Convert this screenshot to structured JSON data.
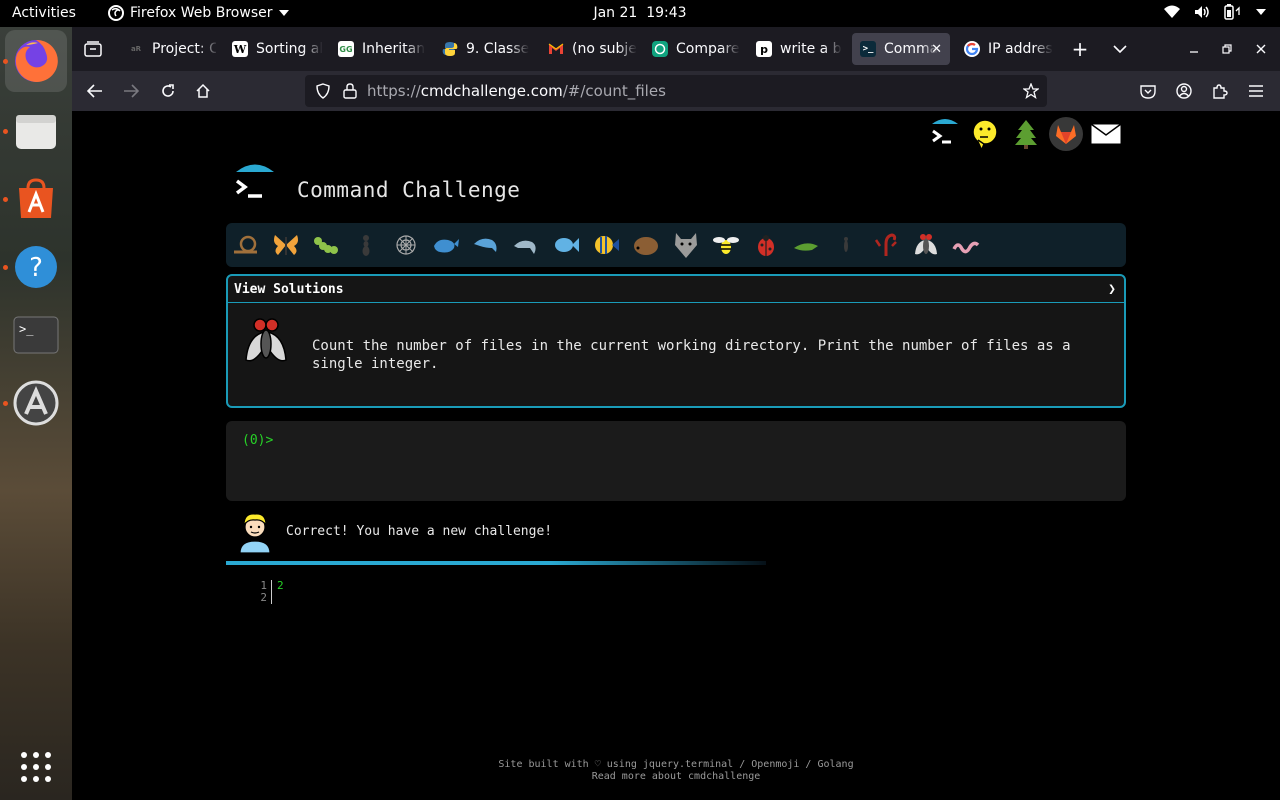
{
  "topbar": {
    "activities": "Activities",
    "app_name": "Firefox Web Browser",
    "date": "Jan 21",
    "time": "19:43",
    "icons": [
      "wifi-icon",
      "volume-icon",
      "battery-icon",
      "power-menu-icon"
    ]
  },
  "dock": {
    "items": [
      {
        "name": "firefox",
        "running": true
      },
      {
        "name": "files",
        "running": true
      },
      {
        "name": "app-center",
        "running": true
      },
      {
        "name": "help",
        "running": true
      },
      {
        "name": "terminal",
        "running": false
      },
      {
        "name": "software-updater",
        "running": true
      }
    ],
    "show_apps": "show-apps-icon"
  },
  "tabs": [
    {
      "label": "Project: C",
      "favicon": "project-icon",
      "active": false
    },
    {
      "label": "Sorting al",
      "favicon": "wikipedia-icon",
      "active": false
    },
    {
      "label": "Inheritan",
      "favicon": "geeksforgeeks-icon",
      "active": false
    },
    {
      "label": "9. Classe",
      "favicon": "python-icon",
      "active": false
    },
    {
      "label": "(no subje",
      "favicon": "gmail-icon",
      "active": false
    },
    {
      "label": "Compare",
      "favicon": "chatgpt-icon",
      "active": false
    },
    {
      "label": "write a b",
      "favicon": "perplexity-icon",
      "active": false
    },
    {
      "label": "Comma",
      "favicon": "cmdchallenge-icon",
      "active": true
    },
    {
      "label": "IP addres",
      "favicon": "google-icon",
      "active": false
    }
  ],
  "url": {
    "proto": "https://",
    "domain": "cmdchallenge.com",
    "path": "/#/count_files"
  },
  "site": {
    "title": "Command Challenge",
    "view_solutions": "View Solutions",
    "chevron": "❯",
    "challenge_text": "Count the number of files in the current working directory. Print the number of files as a single integer.",
    "prompt": "(0)>",
    "feedback": "Correct! You have a new challenge!",
    "output_lines": [
      {
        "num": "1",
        "text": "2"
      },
      {
        "num": "2",
        "text": ""
      }
    ],
    "footer_line1": "Site built with ♡ using jquery.terminal / Openmoji / Golang",
    "footer_line2": "Read more about cmdchallenge"
  },
  "colors": {
    "accent": "#1a9bb8",
    "terminal_green": "#27d327",
    "progress": "#2aa9d2"
  }
}
